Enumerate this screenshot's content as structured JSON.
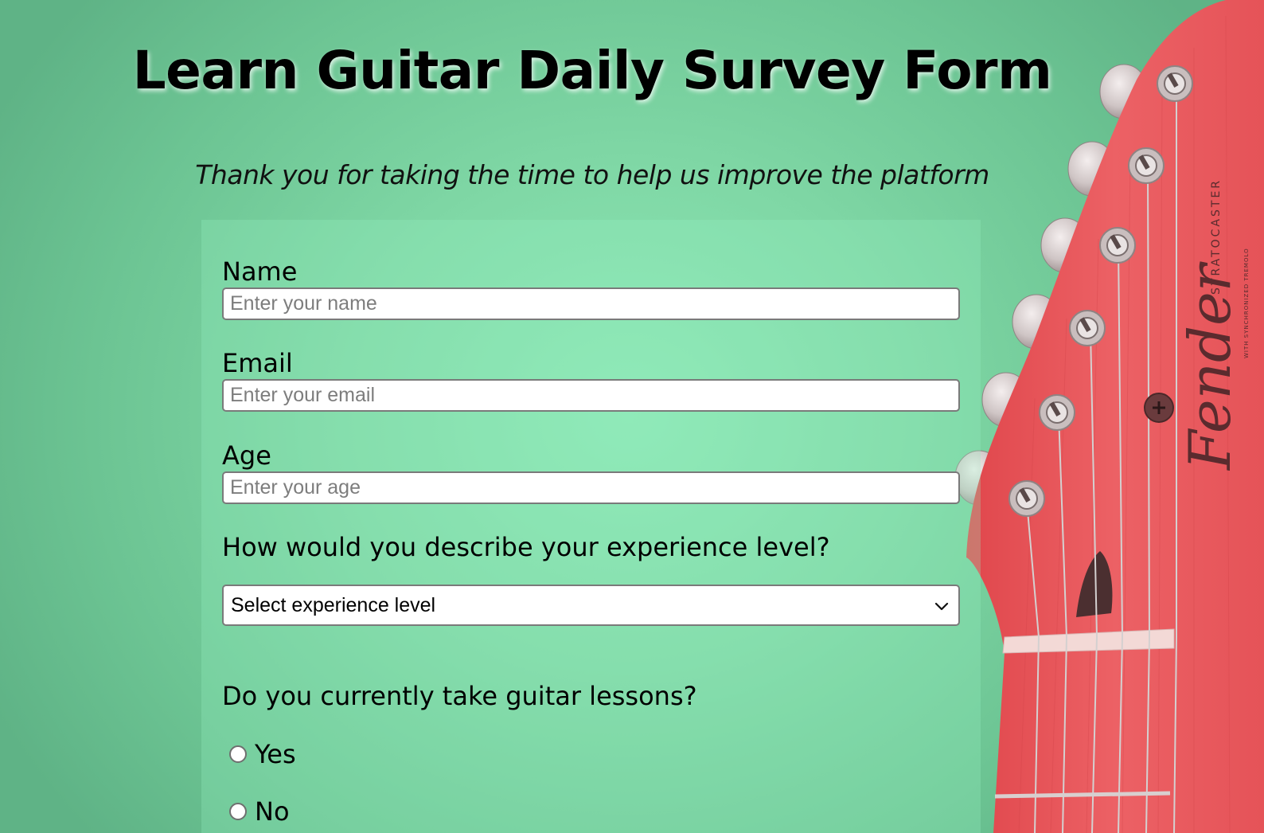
{
  "page": {
    "title": "Learn Guitar Daily Survey Form",
    "description": "Thank you for taking the time to help us improve the platform"
  },
  "form": {
    "name": {
      "label": "Name",
      "placeholder": "Enter your name",
      "value": ""
    },
    "email": {
      "label": "Email",
      "placeholder": "Enter your email",
      "value": ""
    },
    "age": {
      "label": "Age",
      "placeholder": "Enter your age",
      "value": ""
    },
    "experience": {
      "label": "How would you describe your experience level?",
      "selected": "Select experience level"
    },
    "lessons": {
      "question": "Do you currently take guitar lessons?",
      "options": [
        {
          "label": "Yes",
          "checked": false
        },
        {
          "label": "No",
          "checked": false
        }
      ]
    }
  },
  "decor": {
    "headstock_brand": "Fender",
    "headstock_model": "STRATOCASTER",
    "headstock_tagline": "WITH SYNCHRONIZED TREMOLO"
  },
  "colors": {
    "background": "#7fd7a5",
    "guitar_body": "#e8585c",
    "text": "#000000"
  },
  "icons": {
    "select_arrow": "chevron-down-icon"
  }
}
